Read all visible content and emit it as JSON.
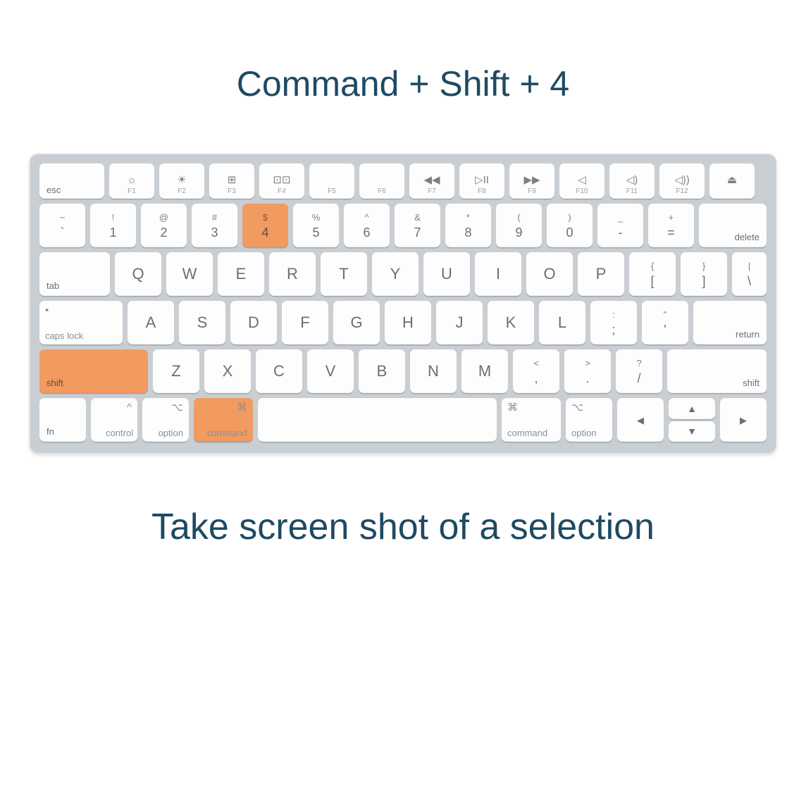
{
  "title": "Command + Shift + 4",
  "caption": "Take screen shot of a selection",
  "highlight_color": "#f19b61",
  "rows": {
    "fn": {
      "esc": "esc",
      "f1": {
        "icon": "☼",
        "label": "F1"
      },
      "f2": {
        "icon": "☀",
        "label": "F2"
      },
      "f3": {
        "icon": "⊞",
        "label": "F3"
      },
      "f4": {
        "icon": "⊡⊡",
        "label": "F4"
      },
      "f5": {
        "label": "F5"
      },
      "f6": {
        "label": "F6"
      },
      "f7": {
        "icon": "◀◀",
        "label": "F7"
      },
      "f8": {
        "icon": "▷II",
        "label": "F8"
      },
      "f9": {
        "icon": "▶▶",
        "label": "F9"
      },
      "f10": {
        "icon": "◁",
        "label": "F10"
      },
      "f11": {
        "icon": "◁)",
        "label": "F11"
      },
      "f12": {
        "icon": "◁))",
        "label": "F12"
      },
      "eject": "⏏"
    },
    "num": {
      "tilde": {
        "top": "~",
        "bot": "`"
      },
      "k1": {
        "top": "!",
        "bot": "1"
      },
      "k2": {
        "top": "@",
        "bot": "2"
      },
      "k3": {
        "top": "#",
        "bot": "3"
      },
      "k4": {
        "top": "$",
        "bot": "4",
        "hl": true
      },
      "k5": {
        "top": "%",
        "bot": "5"
      },
      "k6": {
        "top": "^",
        "bot": "6"
      },
      "k7": {
        "top": "&",
        "bot": "7"
      },
      "k8": {
        "top": "*",
        "bot": "8"
      },
      "k9": {
        "top": "(",
        "bot": "9"
      },
      "k0": {
        "top": ")",
        "bot": "0"
      },
      "minus": {
        "top": "_",
        "bot": "-"
      },
      "equal": {
        "top": "+",
        "bot": "="
      },
      "delete": "delete"
    },
    "qwerty": {
      "tab": "tab",
      "Q": "Q",
      "W": "W",
      "E": "E",
      "R": "R",
      "T": "T",
      "Y": "Y",
      "U": "U",
      "I": "I",
      "O": "O",
      "P": "P",
      "lb": {
        "top": "{",
        "bot": "["
      },
      "rb": {
        "top": "}",
        "bot": "]"
      },
      "bs": {
        "top": "|",
        "bot": "\\"
      }
    },
    "asdf": {
      "caps": {
        "sym": "•",
        "label": "caps lock"
      },
      "A": "A",
      "S": "S",
      "D": "D",
      "F": "F",
      "G": "G",
      "H": "H",
      "J": "J",
      "K": "K",
      "L": "L",
      "semi": {
        "top": ":",
        "bot": ";"
      },
      "quote": {
        "top": "\"",
        "bot": "'"
      },
      "return": "return"
    },
    "zxcv": {
      "lshift": {
        "label": "shift",
        "hl": true
      },
      "Z": "Z",
      "X": "X",
      "C": "C",
      "V": "V",
      "B": "B",
      "N": "N",
      "M": "M",
      "comma": {
        "top": "<",
        "bot": ","
      },
      "period": {
        "top": ">",
        "bot": "."
      },
      "slash": {
        "top": "?",
        "bot": "/"
      },
      "rshift": "shift"
    },
    "bottom": {
      "fn": "fn",
      "ctrl": {
        "sym": "^",
        "label": "control"
      },
      "lopt": {
        "sym": "⌥",
        "label": "option"
      },
      "lcmd": {
        "sym": "⌘",
        "label": "command",
        "hl": true
      },
      "space": "",
      "rcmd": {
        "sym": "⌘",
        "label": "command"
      },
      "ropt": {
        "sym": "⌥",
        "label": "option"
      },
      "left": "◀",
      "up": "▲",
      "down": "▼",
      "right": "▶"
    }
  }
}
